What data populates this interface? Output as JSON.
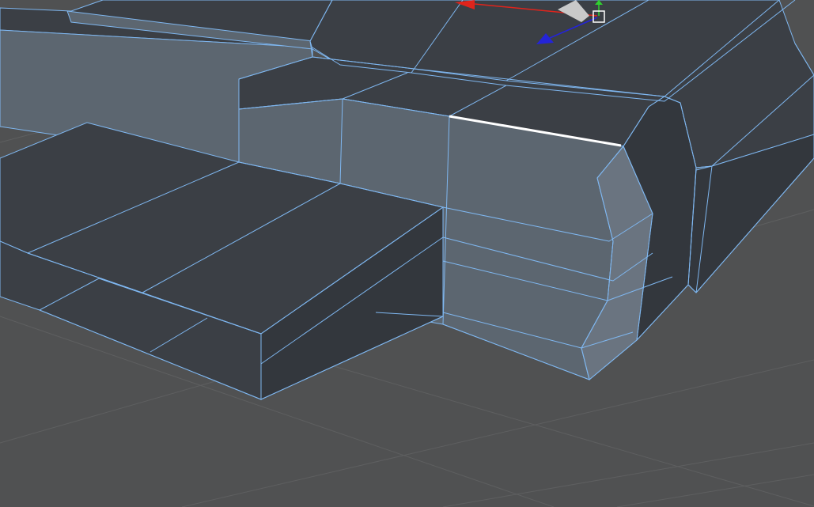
{
  "viewport": {
    "mode": "edge-selection",
    "shading": "shaded-with-wireframe"
  },
  "colors": {
    "background": "#505152",
    "grid_line": "#5e5f60",
    "top_face": "#3b3f45",
    "dark_face": "#33373d",
    "side_face": "#5c6670",
    "side_face_light": "#6a7480",
    "wireframe": "#7fb7f0",
    "selected_edge": "#ffffff",
    "axis_x": "#e0241c",
    "axis_y": "#2fd12f",
    "axis_z": "#2424d8",
    "gizmo_handle": "#c9c9c9"
  },
  "gizmo": {
    "axes": [
      "x",
      "y",
      "z"
    ],
    "icons": [
      "move-x-arrow-icon",
      "move-y-arrow-icon",
      "move-z-arrow-icon",
      "gizmo-center-cube-icon"
    ]
  }
}
